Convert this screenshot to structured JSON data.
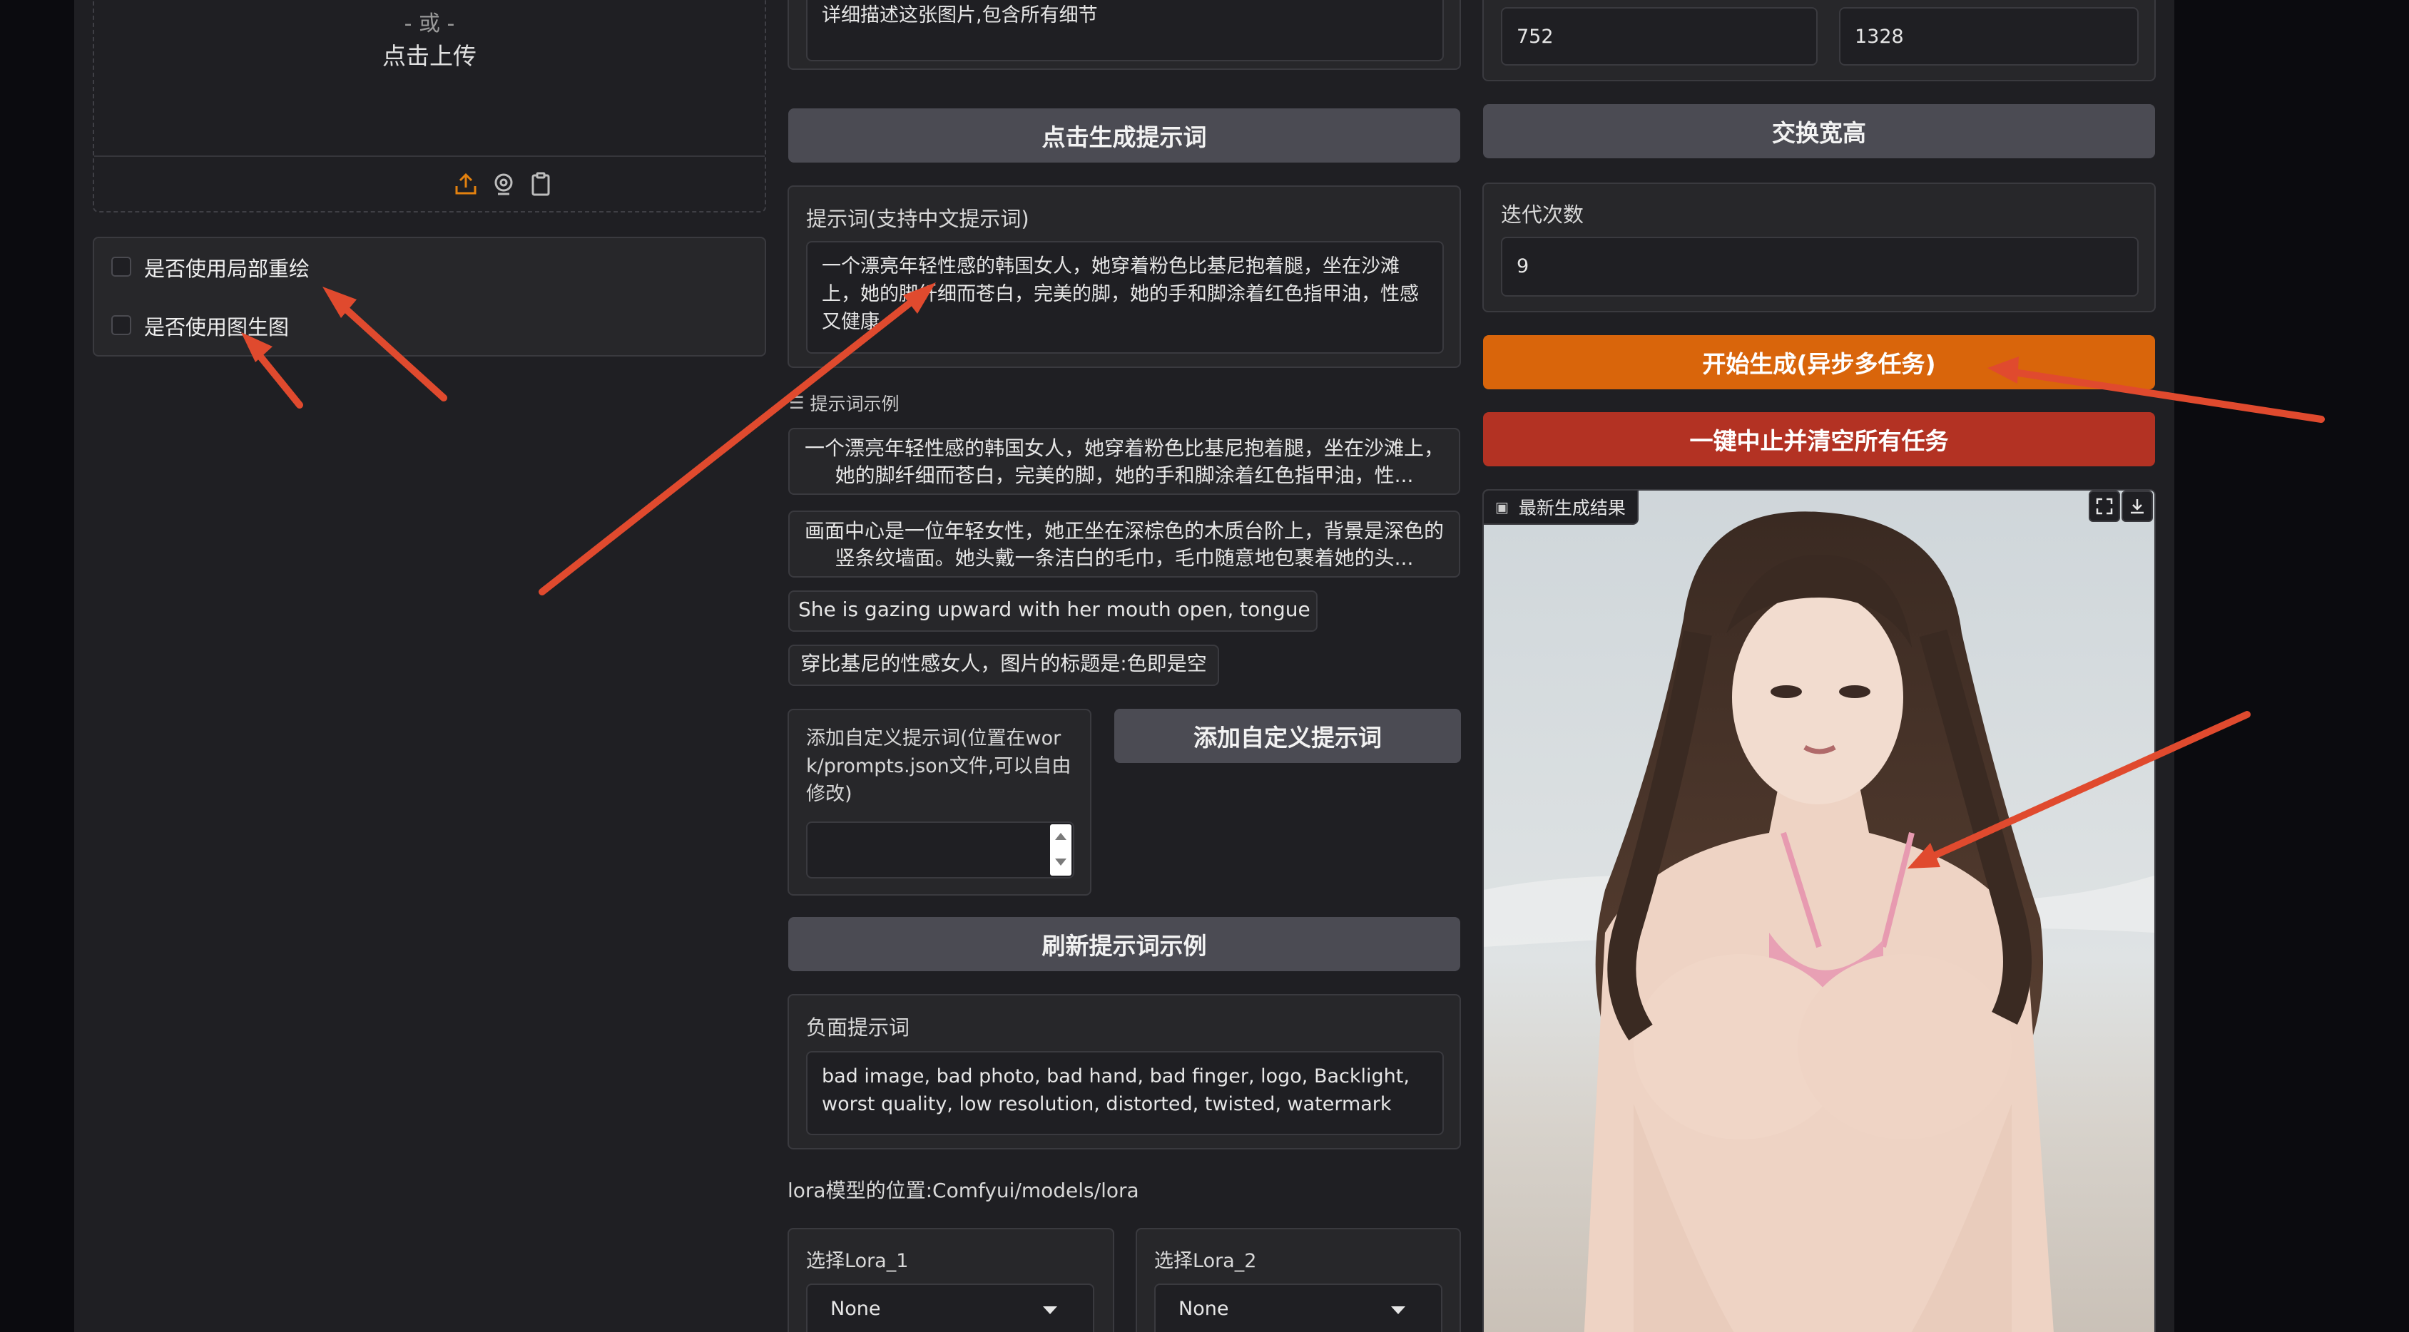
{
  "upload": {
    "or_text": "- 或 -",
    "click_upload": "点击上传"
  },
  "checkboxes": {
    "inpaint_label": "是否使用局部重绘",
    "img2img_label": "是否使用图生图"
  },
  "middle": {
    "describe_text": "详细描述这张图片,包含所有细节",
    "generate_prompt_button": "点击生成提示词",
    "prompt_label": "提示词(支持中文提示词)",
    "prompt_value": "一个漂亮年轻性感的韩国女人，她穿着粉色比基尼抱着腿，坐在沙滩上，她的脚纤细而苍白，完美的脚，她的手和脚涂着红色指甲油，性感又健康",
    "examples_title": "提示词示例",
    "examples": [
      "一个漂亮年轻性感的韩国女人，她穿着粉色比基尼抱着腿，坐在沙滩上，她的脚纤细而苍白，完美的脚，她的手和脚涂着红色指甲油，性...",
      "画面中心是一位年轻女性，她正坐在深棕色的木质台阶上，背景是深色的竖条纹墙面。她头戴一条洁白的毛巾，毛巾随意地包裹着她的头...",
      "She is gazing upward with her mouth open, tongue extended",
      "穿比基尼的性感女人，图片的标题是:色即是空"
    ],
    "custom_prompt_label": "添加自定义提示词(位置在work/prompts.json文件,可以自由修改)",
    "custom_prompt_value": "",
    "add_custom_button": "添加自定义提示词",
    "refresh_button": "刷新提示词示例",
    "negative_label": "负面提示词",
    "negative_value": "bad image, bad photo, bad hand, bad finger, logo, Backlight, worst quality, low resolution, distorted, twisted, watermark",
    "lora_path_text": "lora模型的位置:Comfyui/models/lora",
    "lora1_label": "选择Lora_1",
    "lora1_value": "None",
    "lora2_label": "选择Lora_2",
    "lora2_value": "None"
  },
  "right": {
    "width_value": "752",
    "height_value": "1328",
    "swap_button": "交换宽高",
    "steps_label": "迭代次数",
    "steps_value": "9",
    "start_button": "开始生成(异步多任务)",
    "stop_button": "一键中止并清空所有任务",
    "result_label": "最新生成结果"
  },
  "colors": {
    "accent_orange": "#d9650b",
    "stop_red": "#b33223",
    "annotation_arrow": "#e04a2e"
  }
}
